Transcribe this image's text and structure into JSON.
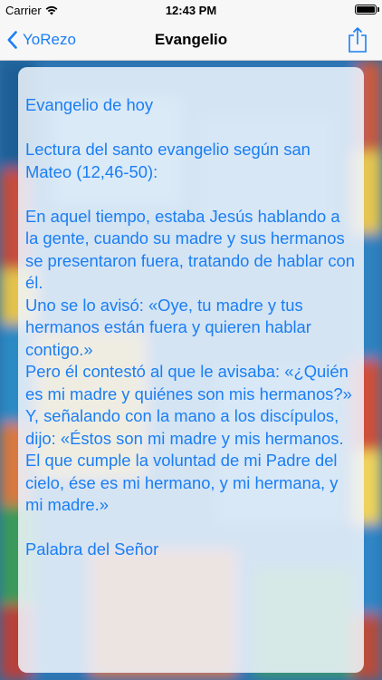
{
  "status_bar": {
    "carrier": "Carrier",
    "time": "12:43 PM",
    "wifi_icon": "wifi-icon",
    "battery_icon": "battery-icon"
  },
  "nav": {
    "back_label": "YoRezo",
    "back_icon": "chevron-left-icon",
    "title": "Evangelio",
    "share_icon": "share-icon"
  },
  "content": {
    "heading": "Evangelio de hoy",
    "reading_title": "Lectura del santo evangelio según san Mateo (12,46-50):",
    "paragraphs": [
      "En aquel tiempo, estaba Jesús hablando a la gente, cuando su madre y sus hermanos se presentaron fuera, tratando de hablar con él.",
      "Uno se lo avisó: «Oye, tu madre y tus hermanos están fuera y quieren hablar contigo.»",
      "Pero él contestó al que le avisaba: «¿Quién es mi madre y quiénes son mis hermanos?»",
      "Y, señalando con la mano a los discípulos, dijo: «Éstos son mi madre y mis hermanos. El que cumple la voluntad de mi Padre del cielo, ése es mi hermano, y mi hermana, y mi madre.»"
    ],
    "closing": "Palabra del Señor"
  },
  "colors": {
    "accent": "#1a7ef5",
    "nav_background": "#f7f7f7",
    "text": "#1a7ef5"
  }
}
